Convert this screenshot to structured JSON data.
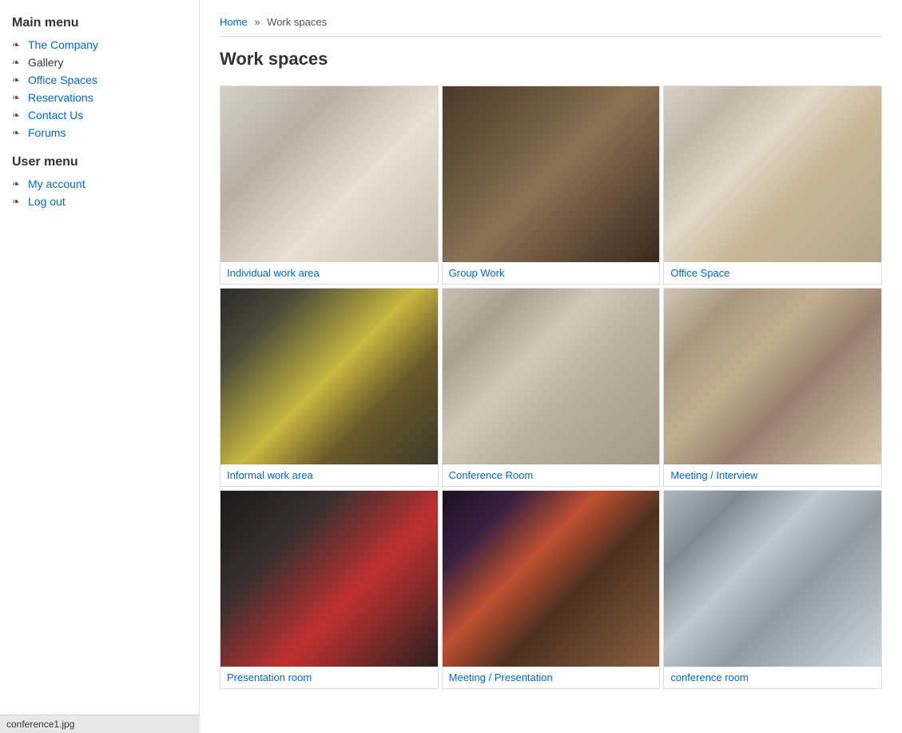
{
  "sidebar": {
    "main_menu_title": "Main menu",
    "user_menu_title": "User menu",
    "main_nav": [
      {
        "label": "The Company",
        "href": true,
        "id": "the-company"
      },
      {
        "label": "Gallery",
        "href": false,
        "id": "gallery"
      },
      {
        "label": "Office Spaces",
        "href": true,
        "id": "office-spaces"
      },
      {
        "label": "Reservations",
        "href": true,
        "id": "reservations"
      },
      {
        "label": "Contact Us",
        "href": true,
        "id": "contact-us"
      },
      {
        "label": "Forums",
        "href": true,
        "id": "forums"
      }
    ],
    "user_nav": [
      {
        "label": "My account",
        "href": true,
        "id": "my-account"
      },
      {
        "label": "Log out",
        "href": true,
        "id": "log-out"
      }
    ]
  },
  "breadcrumb": {
    "home_label": "Home",
    "separator": "»",
    "current": "Work spaces"
  },
  "page": {
    "title": "Work spaces"
  },
  "gallery": {
    "items": [
      {
        "id": "individual-work-area",
        "caption": "Individual work area",
        "img_class": "img-individual"
      },
      {
        "id": "group-work",
        "caption": "Group Work",
        "img_class": "img-group"
      },
      {
        "id": "office-space",
        "caption": "Office Space",
        "img_class": "img-office"
      },
      {
        "id": "informal-work-area",
        "caption": "Informal work area",
        "img_class": "img-informal"
      },
      {
        "id": "conference-room",
        "caption": "Conference Room",
        "img_class": "img-conference"
      },
      {
        "id": "meeting-interview",
        "caption": "Meeting / Interview",
        "img_class": "img-meeting"
      },
      {
        "id": "presentation-room",
        "caption": "Presentation room",
        "img_class": "img-presentation"
      },
      {
        "id": "meeting-presentation",
        "caption": "Meeting / Presentation",
        "img_class": "img-meeting-pres"
      },
      {
        "id": "conference-room-2",
        "caption": "conference room",
        "img_class": "img-conference2"
      }
    ]
  },
  "tooltip": {
    "text": "conference1.jpg"
  }
}
